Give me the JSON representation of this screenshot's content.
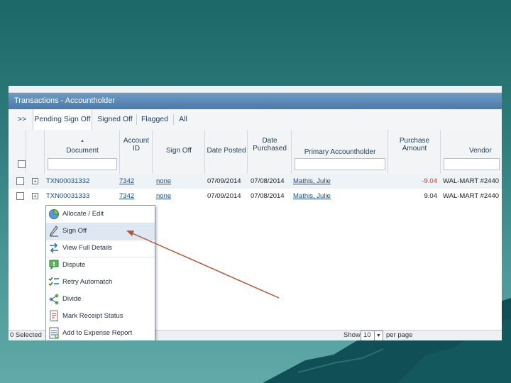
{
  "window": {
    "title": "Transactions - Accountholder"
  },
  "tabs": [
    {
      "label": ">>"
    },
    {
      "label": "Pending Sign Off"
    },
    {
      "label": "Signed Off"
    },
    {
      "label": "Flagged"
    },
    {
      "label": "All"
    }
  ],
  "columns": {
    "document": "Document",
    "account_id_1": "Account",
    "account_id_2": "ID",
    "sign_off": "Sign Off",
    "date_posted": "Date Posted",
    "date_purchased_1": "Date",
    "date_purchased_2": "Purchased",
    "primary_accountholder": "Primary Accountholder",
    "purchase_amount_1": "Purchase",
    "purchase_amount_2": "Amount",
    "vendor": "Vendor"
  },
  "rows": [
    {
      "document": "TXN00031332",
      "account_id": "7342",
      "sign_off": "none",
      "date_posted": "07/09/2014",
      "date_purchased": "07/08/2014",
      "accountholder": "Mathis, Julie",
      "amount": "-9.04",
      "vendor": "WAL-MART #2440"
    },
    {
      "document": "TXN00031333",
      "account_id": "7342",
      "sign_off": "none",
      "date_posted": "07/09/2014",
      "date_purchased": "07/08/2014",
      "accountholder": "Mathis, Julie",
      "amount": "9.04",
      "vendor": "WAL-MART #2440"
    }
  ],
  "context_menu": [
    {
      "label": "Allocate / Edit",
      "icon": "pie-chart-icon"
    },
    {
      "label": "Sign Off",
      "icon": "pen-icon"
    },
    {
      "label": "View Full Details",
      "icon": "swap-arrows-icon"
    },
    {
      "label": "Dispute",
      "icon": "dispute-icon"
    },
    {
      "label": "Retry Automatch",
      "icon": "checklist-icon"
    },
    {
      "label": "Divide",
      "icon": "divide-icon"
    },
    {
      "label": "Mark Receipt Status",
      "icon": "receipt-icon"
    },
    {
      "label": "Add to Expense Report",
      "icon": "expense-report-icon"
    }
  ],
  "footer": {
    "selected": "0 Selected",
    "show_label": "Show",
    "page_size": "10",
    "per_page": "per page"
  },
  "colors": {
    "title_bar": "#4b7aa9",
    "link": "#1a4d8f",
    "negative": "#c0392b",
    "annotation_arrow": "#b5563d"
  }
}
